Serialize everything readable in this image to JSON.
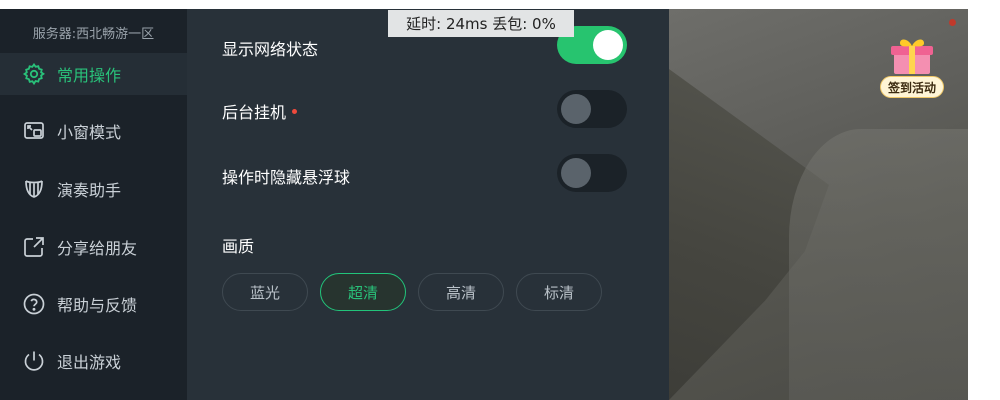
{
  "server": "服务器:西北畅游一区",
  "sidebar": {
    "items": [
      {
        "label": "常用操作",
        "icon": "gear-icon"
      },
      {
        "label": "小窗模式",
        "icon": "small-window-icon"
      },
      {
        "label": "演奏助手",
        "icon": "harp-icon"
      },
      {
        "label": "分享给朋友",
        "icon": "share-icon"
      },
      {
        "label": "帮助与反馈",
        "icon": "help-icon"
      },
      {
        "label": "退出游戏",
        "icon": "power-icon"
      }
    ],
    "active_index": 0
  },
  "latency": {
    "text": "延时: 24ms 丢包: 0%"
  },
  "settings": {
    "network_status": {
      "label": "显示网络状态",
      "on": true
    },
    "background_idle": {
      "label": "后台挂机",
      "on": false
    },
    "hide_float_ball": {
      "label": "操作时隐藏悬浮球",
      "on": false
    }
  },
  "quality": {
    "label": "画质",
    "options": [
      "蓝光",
      "超清",
      "高清",
      "标清"
    ],
    "selected_index": 1
  },
  "checkin": {
    "label": "签到活动",
    "icon": "gift-icon"
  },
  "colors": {
    "accent": "#29c27a",
    "sidebar_bg": "#1b2229",
    "panel_bg": "#283139",
    "toggle_on": "#27c46f",
    "notice_dot": "#ef4a3c"
  }
}
